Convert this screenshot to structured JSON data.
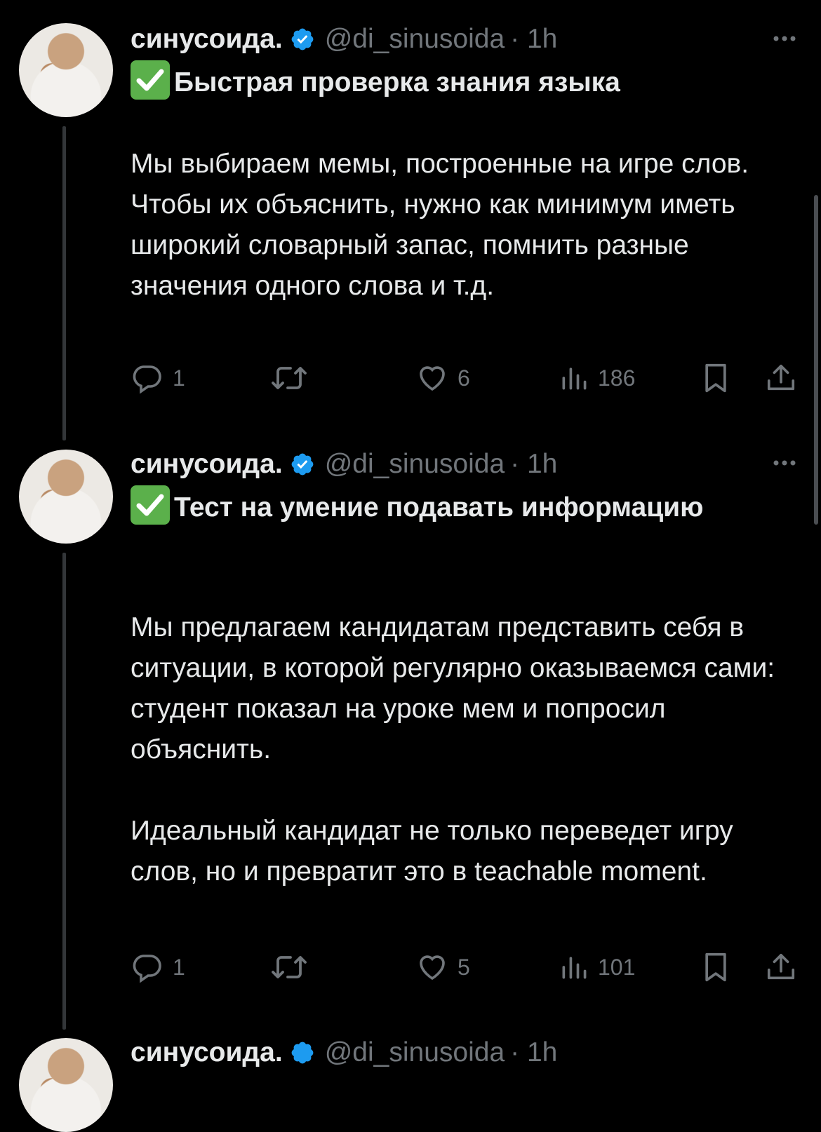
{
  "tweets": [
    {
      "name": "синусоида.",
      "handle": "@di_sinusoida",
      "time": "· 1h",
      "title": "Быстрая проверка знания языка",
      "paragraphs": [
        "Мы выбираем мемы, построенные на игре слов. Чтобы их объяснить, нужно как минимум иметь широкий словарный запас, помнить разные значения одного слова и т.д."
      ],
      "replies": "1",
      "retweets": "",
      "likes": "6",
      "views": "186"
    },
    {
      "name": "синусоида.",
      "handle": "@di_sinusoida",
      "time": "· 1h",
      "title": "Тест на умение подавать информацию",
      "paragraphs": [
        "Мы предлагаем кандидатам представить себя в ситуации, в которой регулярно оказываемся сами: студент показал на уроке мем и попросил объяснить.",
        "Идеальный кандидат не только переведет игру слов, но и превратит это в teachable moment."
      ],
      "replies": "1",
      "retweets": "",
      "likes": "5",
      "views": "101"
    },
    {
      "name": "синусоида.",
      "handle": "@di_sinusoida",
      "time": "· 1h"
    }
  ],
  "icons": {
    "reply": "reply-icon",
    "retweet": "retweet-icon",
    "like": "heart-icon",
    "views": "views-icon",
    "bookmark": "bookmark-icon",
    "share": "share-icon",
    "more": "more-icon",
    "verified": "verified-badge-icon",
    "check": "check-mark-emoji"
  },
  "colors": {
    "background": "#000000",
    "text": "#e7e9ea",
    "secondary": "#71767b",
    "verified": "#1d9bf0",
    "check_emoji": "#5bb04b"
  }
}
